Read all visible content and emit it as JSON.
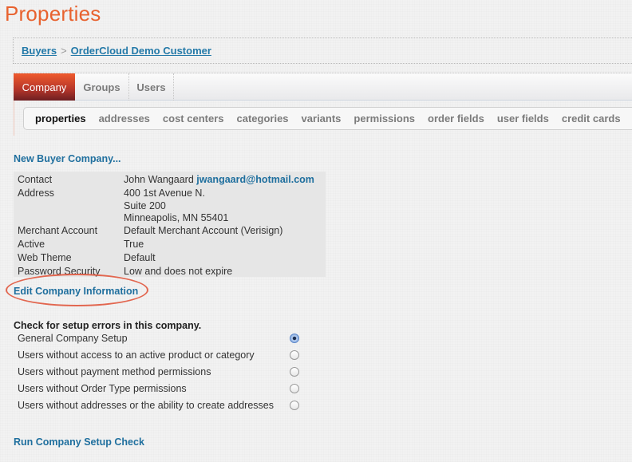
{
  "page": {
    "title": "Properties"
  },
  "breadcrumb": [
    {
      "label": "Buyers"
    },
    {
      "label": "OrderCloud Demo Customer"
    }
  ],
  "breadcrumb_separator": ">",
  "tabs": [
    {
      "label": "Company",
      "active": true
    },
    {
      "label": "Groups",
      "active": false
    },
    {
      "label": "Users",
      "active": false
    }
  ],
  "subnav": [
    {
      "label": "properties",
      "active": true
    },
    {
      "label": "addresses"
    },
    {
      "label": "cost centers"
    },
    {
      "label": "categories"
    },
    {
      "label": "variants"
    },
    {
      "label": "permissions"
    },
    {
      "label": "order fields"
    },
    {
      "label": "user fields"
    },
    {
      "label": "credit cards"
    }
  ],
  "new_buyer_link": "New Buyer Company...",
  "company_info": {
    "contact_label": "Contact",
    "contact_name": "John Wangaard",
    "contact_email": "jwangaard@hotmail.com",
    "address_label": "Address",
    "address_line1": "400 1st Avenue N.",
    "address_line2": "Suite 200",
    "address_line3": "Minneapolis, MN 55401",
    "merchant_label": "Merchant Account",
    "merchant_value": "Default Merchant Account (Verisign)",
    "active_label": "Active",
    "active_value": "True",
    "theme_label": "Web Theme",
    "theme_value": "Default",
    "password_label": "Password Security",
    "password_value": "Low and does not expire"
  },
  "edit_link": "Edit Company Information",
  "setup_check": {
    "title": "Check for setup errors in this company.",
    "options": [
      {
        "label": "General Company Setup",
        "selected": true
      },
      {
        "label": "Users without access to an active product or category",
        "selected": false
      },
      {
        "label": "Users without payment method permissions",
        "selected": false
      },
      {
        "label": "Users without Order Type permissions",
        "selected": false
      },
      {
        "label": "Users without addresses or the ability to create addresses",
        "selected": false
      }
    ],
    "run_label": "Run Company Setup Check"
  },
  "colors": {
    "title": "#e8622f",
    "link": "#1f6f9e",
    "active_tab": "#b4352a",
    "highlight_oval": "#e2664f"
  }
}
